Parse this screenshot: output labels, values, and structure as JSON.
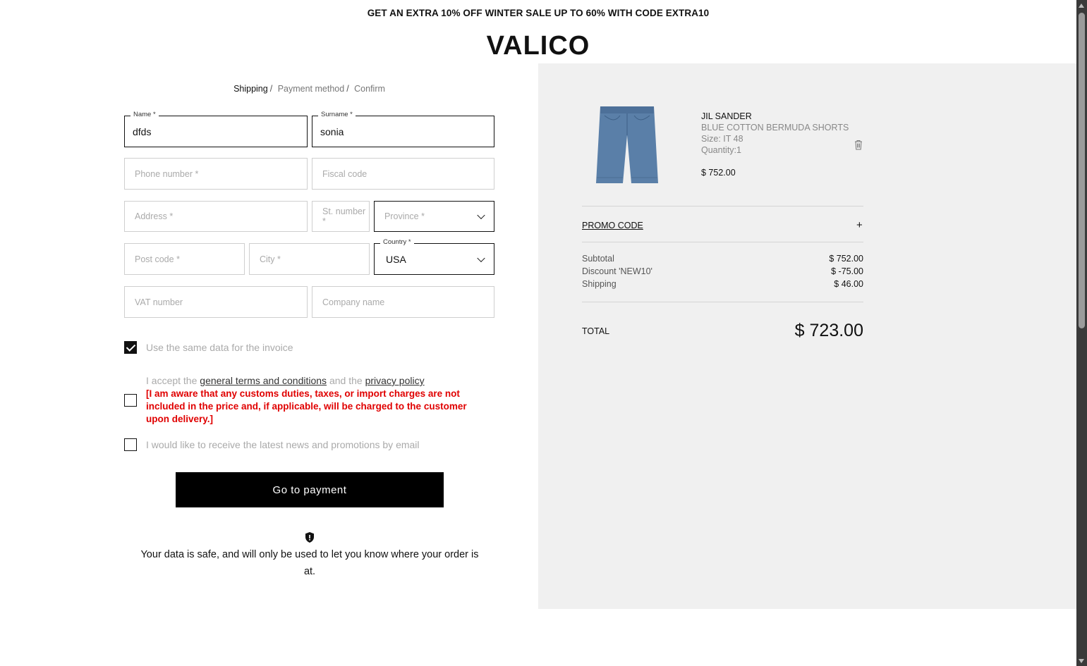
{
  "announcement": "GET AN EXTRA 10% OFF WINTER SALE UP TO 60% WITH CODE EXTRA10",
  "brand": "VALICO",
  "breadcrumb": {
    "step1": "Shipping",
    "step2": "Payment method",
    "step3": "Confirm",
    "separator": "/"
  },
  "form": {
    "name": {
      "label": "Name *",
      "value": "dfds"
    },
    "surname": {
      "label": "Surname *",
      "value": "sonia"
    },
    "phone": {
      "placeholder": "Phone number *"
    },
    "fiscal": {
      "placeholder": "Fiscal code"
    },
    "address": {
      "placeholder": "Address *"
    },
    "st_number": {
      "placeholder": "St. number *"
    },
    "province": {
      "placeholder": "Province *"
    },
    "post_code": {
      "placeholder": "Post code *"
    },
    "city": {
      "placeholder": "City *"
    },
    "country": {
      "label": "Country *",
      "value": "USA"
    },
    "vat": {
      "placeholder": "VAT number"
    },
    "company": {
      "placeholder": "Company name"
    }
  },
  "options": {
    "same_data": {
      "label": "Use the same data for the invoice",
      "checked": true
    },
    "terms": {
      "prefix": "I accept the",
      "terms_link": "general terms and conditions",
      "middle": "and the",
      "privacy_link": "privacy policy",
      "warning": "[I am aware that any customs duties, taxes, or import charges are not included in the price and, if applicable, will be charged to the customer upon delivery.]",
      "checked": false
    },
    "newsletter": {
      "label": "I would like to receive the latest news and promotions by email",
      "checked": false
    }
  },
  "cta": {
    "label": "Go to payment"
  },
  "safe_note": "Your data is safe, and will only be used to let you know where your order is at.",
  "icons": {
    "shield": "shield-icon",
    "trash": "trash-icon",
    "chevron": "chevron-down-icon",
    "check": "check-icon"
  },
  "cart": {
    "item": {
      "brand": "JIL SANDER",
      "name": "BLUE COTTON BERMUDA SHORTS",
      "size": "Size: IT 48",
      "quantity": "Quantity:1",
      "price": "$ 752.00"
    },
    "promo_label": "PROMO CODE",
    "promo_toggle": "+",
    "summary": [
      {
        "label": "Subtotal",
        "value": "$ 752.00"
      },
      {
        "label": "Discount 'NEW10'",
        "value": "$ -75.00"
      },
      {
        "label": "Shipping",
        "value": "$ 46.00"
      }
    ],
    "total_label": "TOTAL",
    "total_value": "$ 723.00"
  },
  "colors": {
    "warning": "#e00000",
    "panel": "#f0f0f0",
    "primary": "#000000",
    "product": "#5a7fa8"
  }
}
